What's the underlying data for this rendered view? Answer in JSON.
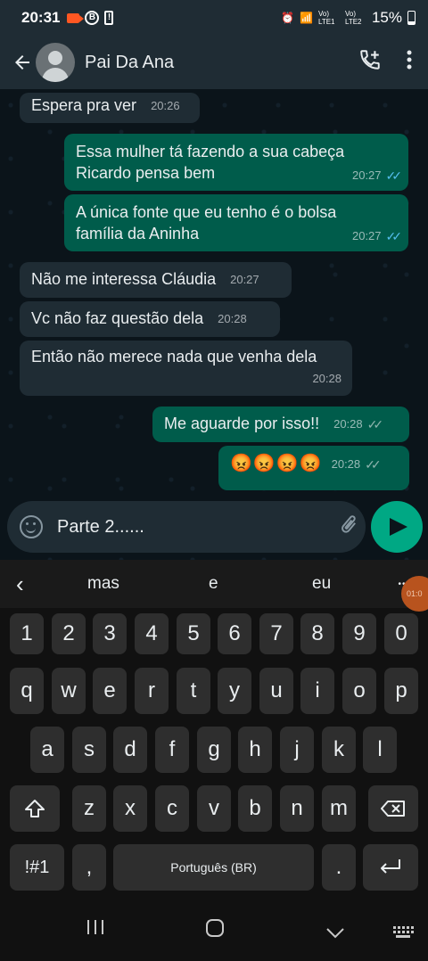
{
  "status_bar": {
    "time": "20:31",
    "b_icon": "B",
    "bang_icon": "!",
    "alarm_icon": "alarm-icon",
    "sim1": "Vo) LTE1",
    "sim2": "Vo) LTE2",
    "battery": "15%"
  },
  "header": {
    "contact_name": "Pai Da Ana"
  },
  "messages": [
    {
      "dir": "in",
      "text": "Espera pra ver",
      "time": "20:26"
    },
    {
      "dir": "out",
      "text": "Essa mulher tá fazendo a sua cabeça Ricardo pensa bem",
      "time": "20:27",
      "read": true
    },
    {
      "dir": "out",
      "text": "A única fonte que eu tenho é o bolsa família da Aninha",
      "time": "20:27",
      "read": true
    },
    {
      "dir": "in",
      "text": "Não me interessa Cláudia",
      "time": "20:27"
    },
    {
      "dir": "in",
      "text": "Vc não faz questão dela",
      "time": "20:28"
    },
    {
      "dir": "in",
      "text": "Então não merece nada que venha dela",
      "time": "20:28"
    },
    {
      "dir": "out",
      "text": "Me aguarde por isso!!",
      "time": "20:28",
      "read": false
    },
    {
      "dir": "out",
      "text": "😡😡😡😡",
      "time": "20:28",
      "read": false
    }
  ],
  "compose": {
    "value": "Parte 2......"
  },
  "keyboard": {
    "suggestions": [
      "mas",
      "e",
      "eu"
    ],
    "more": "•••",
    "rec_timer": "01:0",
    "row_numbers": [
      "1",
      "2",
      "3",
      "4",
      "5",
      "6",
      "7",
      "8",
      "9",
      "0"
    ],
    "row1": [
      "q",
      "w",
      "e",
      "r",
      "t",
      "y",
      "u",
      "i",
      "o",
      "p"
    ],
    "row2": [
      "a",
      "s",
      "d",
      "f",
      "g",
      "h",
      "j",
      "k",
      "l"
    ],
    "row3": [
      "z",
      "x",
      "c",
      "v",
      "b",
      "n",
      "m"
    ],
    "symbols_key": "!#1",
    "comma_key": ",",
    "space_label": "Português (BR)",
    "period_key": "."
  }
}
